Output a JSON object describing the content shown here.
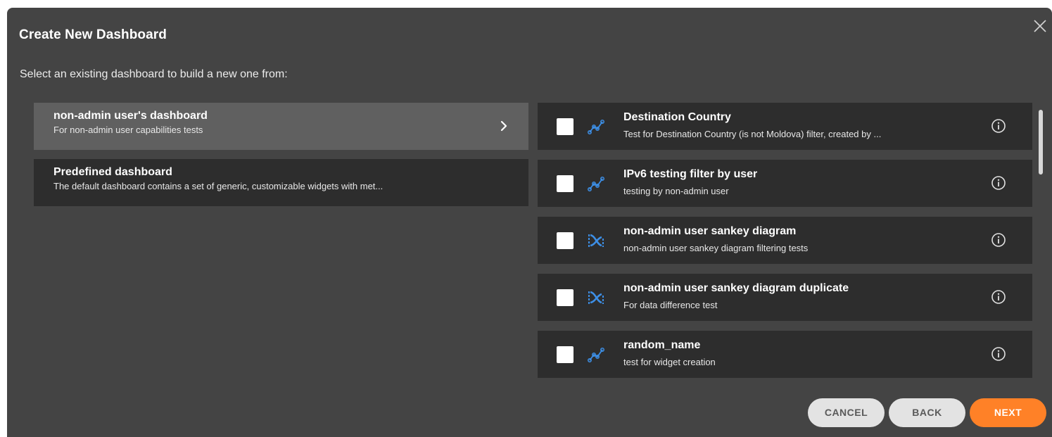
{
  "dialog": {
    "title": "Create New Dashboard",
    "subtitle": "Select an existing dashboard to build a new one from:"
  },
  "dashboards": [
    {
      "name": "non-admin user's dashboard",
      "description": "For non-admin user capabilities tests",
      "selected": true
    },
    {
      "name": "Predefined dashboard",
      "description": "The default dashboard contains a set of generic, customizable widgets with met...",
      "selected": false
    }
  ],
  "widgets": [
    {
      "name": "Destination Country",
      "description": "Test for Destination Country (is not Moldova) filter, created by ...",
      "icon": "line-chart-icon",
      "checked": false
    },
    {
      "name": "IPv6 testing filter by user",
      "description": "testing by non-admin user",
      "icon": "line-chart-icon",
      "checked": false
    },
    {
      "name": "non-admin user sankey diagram",
      "description": "non-admin user sankey diagram filtering tests",
      "icon": "sankey-icon",
      "checked": false
    },
    {
      "name": "non-admin user sankey diagram duplicate",
      "description": "For data difference test",
      "icon": "sankey-icon",
      "checked": false
    },
    {
      "name": "random_name",
      "description": "test for widget creation",
      "icon": "line-chart-icon",
      "checked": false
    }
  ],
  "buttons": {
    "cancel": "CANCEL",
    "back": "BACK",
    "next": "NEXT"
  },
  "colors": {
    "dialog_bg": "#444444",
    "item_bg": "#2d2d2d",
    "selected_bg": "#606060",
    "accent": "#ff8127",
    "icon_blue": "#3d8fe6"
  }
}
